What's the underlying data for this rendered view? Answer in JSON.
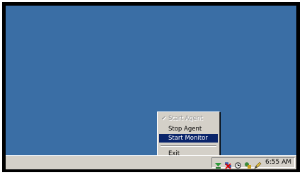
{
  "menu": {
    "items": [
      {
        "label": "Start Agent",
        "checked": true,
        "enabled": false
      },
      {
        "label": "Stop Agent",
        "enabled": true
      },
      {
        "label": "Start Monitor",
        "enabled": true,
        "highlighted": true
      },
      {
        "label": "Exit",
        "enabled": true
      }
    ]
  },
  "tray": {
    "icons": [
      "green-arrow-icon",
      "network-disconnected-icon",
      "clock-app-icon",
      "tools-icon",
      "pencil-icon"
    ],
    "time": "6:55 AM"
  },
  "colors": {
    "desktop": "#3a6ea5",
    "taskbar": "#d4d0c8",
    "highlight": "#0a246a"
  }
}
